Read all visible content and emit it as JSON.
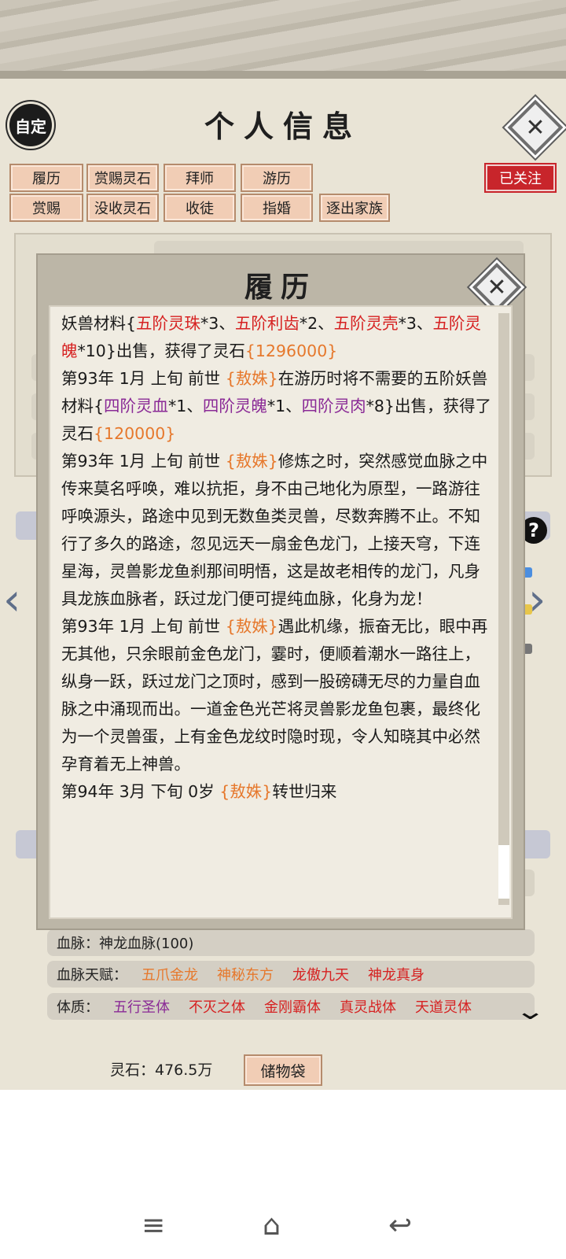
{
  "header": {
    "auto_badge": "自定",
    "title": "个人信息"
  },
  "follow_badge": "已关注",
  "actions_row1": [
    "履历",
    "赏赐灵石",
    "拜师",
    "游历"
  ],
  "actions_row2": [
    "赏赐",
    "没收灵石",
    "收徒",
    "指婚",
    "逐出家族"
  ],
  "modal": {
    "title": "履历",
    "log_entries": [
      {
        "segments": [
          {
            "t": "妖兽材料{",
            "c": ""
          },
          {
            "t": "五阶灵珠",
            "c": "rd"
          },
          {
            "t": "*3、",
            "c": ""
          },
          {
            "t": "五阶利齿",
            "c": "rd"
          },
          {
            "t": "*2、",
            "c": ""
          },
          {
            "t": "五阶灵壳",
            "c": "rd"
          },
          {
            "t": "*3、",
            "c": ""
          },
          {
            "t": "五阶灵魄",
            "c": "rd"
          },
          {
            "t": "*10}出售，获得了灵石",
            "c": ""
          },
          {
            "t": "{1296000}",
            "c": "org"
          }
        ]
      },
      {
        "segments": [
          {
            "t": "第93年 1月 上旬  前世  ",
            "c": ""
          },
          {
            "t": "{敖姝}",
            "c": "org"
          },
          {
            "t": "在游历时将不需要的五阶妖兽材料{",
            "c": ""
          },
          {
            "t": "四阶灵血",
            "c": "pp"
          },
          {
            "t": "*1、",
            "c": ""
          },
          {
            "t": "四阶灵魄",
            "c": "pp"
          },
          {
            "t": "*1、",
            "c": ""
          },
          {
            "t": "四阶灵肉",
            "c": "pp"
          },
          {
            "t": "*8}出售，获得了灵石",
            "c": ""
          },
          {
            "t": "{120000}",
            "c": "org"
          }
        ]
      },
      {
        "segments": [
          {
            "t": "第93年 1月 上旬  前世  ",
            "c": ""
          },
          {
            "t": "{敖姝}",
            "c": "org"
          },
          {
            "t": "修炼之时，突然感觉血脉之中传来莫名呼唤，难以抗拒，身不由己地化为原型，一路游往呼唤源头，路途中见到无数鱼类灵兽，尽数奔腾不止。不知行了多久的路途，忽见远天一扇金色龙门，上接天穹，下连星海，灵兽影龙鱼刹那间明悟，这是故老相传的龙门，凡身具龙族血脉者，跃过龙门便可提纯血脉，化身为龙！",
            "c": ""
          }
        ]
      },
      {
        "segments": [
          {
            "t": "第93年 1月 上旬  前世  ",
            "c": ""
          },
          {
            "t": "{敖姝}",
            "c": "org"
          },
          {
            "t": "遇此机缘，振奋无比，眼中再无其他，只余眼前金色龙门，霎时，便顺着潮水一路往上，纵身一跃，跃过龙门之顶时，感到一股磅礴无尽的力量自血脉之中涌现而出。一道金色光芒将灵兽影龙鱼包裹，最终化为一个灵兽蛋，上有金色龙纹时隐时现，令人知晓其中必然孕育着无上神兽。",
            "c": ""
          }
        ]
      },
      {
        "segments": [
          {
            "t": "第94年 3月 下旬  0岁  ",
            "c": ""
          },
          {
            "t": "{敖姝}",
            "c": "org"
          },
          {
            "t": "转世归来",
            "c": ""
          }
        ]
      }
    ]
  },
  "bloodline": {
    "label": "血脉：",
    "value": "神龙血脉(100)"
  },
  "bloodline_talent": {
    "label": "血脉天赋：",
    "tags": [
      {
        "text": "五爪金龙",
        "color": "orange"
      },
      {
        "text": "神秘东方",
        "color": "orange"
      },
      {
        "text": "龙傲九天",
        "color": "red"
      },
      {
        "text": "神龙真身",
        "color": "red"
      }
    ]
  },
  "physique": {
    "label": "体质：",
    "tags": [
      {
        "text": "五行圣体",
        "color": "purple"
      },
      {
        "text": "不灭之体",
        "color": "red"
      },
      {
        "text": "金刚霸体",
        "color": "red"
      },
      {
        "text": "真灵战体",
        "color": "red"
      },
      {
        "text": "天道灵体",
        "color": "red"
      }
    ]
  },
  "footer": {
    "spirit_stone": "灵石：476.5万",
    "storage_button": "储物袋"
  },
  "colors": {
    "orange": "#e6782c",
    "red": "#d62121",
    "purple": "#8a2a96",
    "follow": "#c8252b",
    "button": "#f1cdb5"
  },
  "icons": [
    "close-icon",
    "chevron-left-icon",
    "chevron-right-icon",
    "help-icon",
    "chevron-down-icon",
    "menu-icon",
    "home-icon",
    "back-icon"
  ]
}
